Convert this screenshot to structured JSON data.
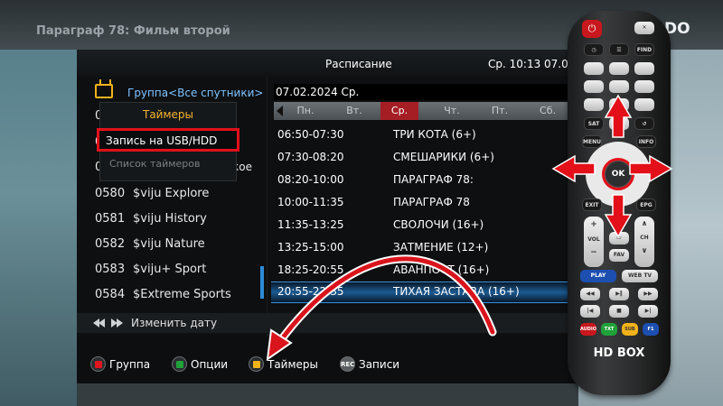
{
  "top_title": "Параграф 78: Фильм второй",
  "top_brand": "DO",
  "header": {
    "title": "Расписание",
    "clock": "Ср. 10:13 07.02"
  },
  "group": {
    "label": "Группа<Все спутники>"
  },
  "popup": {
    "title": "Таймеры",
    "items": [
      "Запись на USB/HDD",
      "Список таймеров"
    ]
  },
  "partial": {
    "row1_num": "0",
    "row2_num": "0",
    "row3_num": "0",
    "row3_suffix": "кое"
  },
  "channels": [
    {
      "num": "0580",
      "name": "$viju Explore"
    },
    {
      "num": "0581",
      "name": "$viju History"
    },
    {
      "num": "0582",
      "name": "$viju Nature"
    },
    {
      "num": "0583",
      "name": "$viju+ Sport"
    },
    {
      "num": "0584",
      "name": "$Extreme Sports"
    }
  ],
  "schedule": {
    "date": "07.02.2024 Ср.",
    "days": [
      "Пн.",
      "Вт.",
      "Ср.",
      "Чт.",
      "Пт.",
      "Сб."
    ],
    "active_day_index": 2,
    "programs": [
      {
        "time": "06:50-07:30",
        "name": "ТРИ КОТА (6+)"
      },
      {
        "time": "07:30-08:20",
        "name": "СМЕШАРИКИ (6+)"
      },
      {
        "time": "08:20-10:00",
        "name": "ПАРАГРАФ 78:"
      },
      {
        "time": "10:00-11:35",
        "name": "ПАРАГРАФ 78"
      },
      {
        "time": "11:35-13:25",
        "name": "СВОЛОЧИ (16+)"
      },
      {
        "time": "13:25-15:00",
        "name": "ЗАТМЕНИЕ (12+)"
      },
      {
        "time": "18:25-20:55",
        "name": "АВАНПОСТ (16+)"
      },
      {
        "time": "20:55-22:35",
        "name": "ТИХАЯ ЗАСТАВА (16+)"
      }
    ],
    "selected_index": 7
  },
  "change_date": "Изменить дату",
  "footer": {
    "buttons": [
      {
        "label": "Группа",
        "color": "#e0161e",
        "icon": "red-button-icon"
      },
      {
        "label": "Опции",
        "color": "#1fa23a",
        "icon": "green-button-icon"
      },
      {
        "label": "Таймеры",
        "color": "#f2b21a",
        "icon": "yellow-button-icon"
      },
      {
        "label": "Записи",
        "badge": "REC",
        "icon": "rec-button-icon"
      }
    ]
  },
  "remote": {
    "brand": "HD BOX",
    "ok": "OK",
    "keys": {
      "find": "FIND",
      "sat": "SAT",
      "menu": "MENU",
      "info": "INFO",
      "exit": "EXIT",
      "epg": "EPG",
      "vol": "VOL",
      "ch": "CH",
      "fav": "FAV",
      "play": "PLAY",
      "webtv": "WEB TV",
      "audio": "AUDIO",
      "txt": "TXT",
      "sub": "SUB",
      "f1": "F1"
    }
  },
  "colors": {
    "accent_red": "#e3101a",
    "selection_blue": "#1b5a92",
    "group_blue": "#7ec3ff",
    "popup_title": "#f5b630"
  }
}
